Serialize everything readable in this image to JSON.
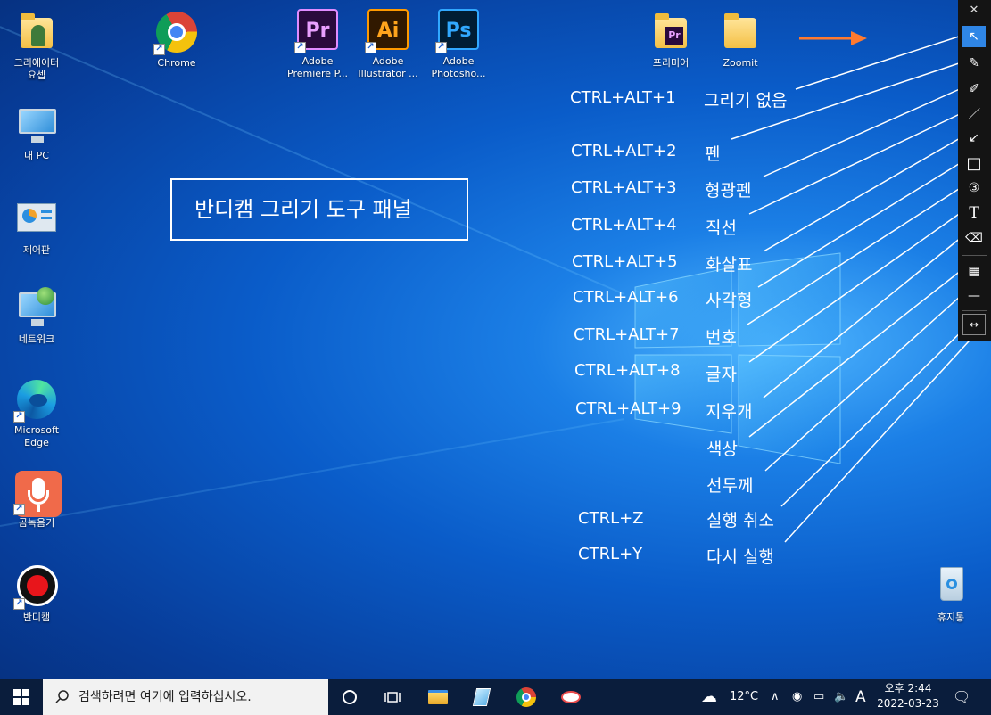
{
  "desktop_icons": [
    {
      "label": "크리에이터\n요셉"
    },
    {
      "label": "내 PC"
    },
    {
      "label": "제어판"
    },
    {
      "label": "네트워크"
    },
    {
      "label": "Microsoft\nEdge"
    },
    {
      "label": "곰녹음기"
    },
    {
      "label": "반디캠"
    },
    {
      "label": "Chrome"
    },
    {
      "label": "Adobe\nPremiere P...",
      "badge": "Pr"
    },
    {
      "label": "Adobe\nIllustrator ...",
      "badge": "Ai"
    },
    {
      "label": "Adobe\nPhotosho...",
      "badge": "Ps"
    },
    {
      "label": "프리미어"
    },
    {
      "label": "Zoomit"
    },
    {
      "label": "휴지통"
    }
  ],
  "title_box": "반디캠 그리기 도구 패널",
  "shortcuts": [
    {
      "keys": "CTRL+ALT+1",
      "desc": "그리기 없음"
    },
    {
      "keys": "CTRL+ALT+2",
      "desc": "펜"
    },
    {
      "keys": "CTRL+ALT+3",
      "desc": "형광펜"
    },
    {
      "keys": "CTRL+ALT+4",
      "desc": "직선"
    },
    {
      "keys": "CTRL+ALT+5",
      "desc": "화살표"
    },
    {
      "keys": "CTRL+ALT+6",
      "desc": "사각형"
    },
    {
      "keys": "CTRL+ALT+7",
      "desc": "번호"
    },
    {
      "keys": "CTRL+ALT+8",
      "desc": "글자"
    },
    {
      "keys": "CTRL+ALT+9",
      "desc": "지우개"
    },
    {
      "keys": "",
      "desc": "색상"
    },
    {
      "keys": "",
      "desc": "선두께"
    },
    {
      "keys": "CTRL+Z",
      "desc": "실행 취소"
    },
    {
      "keys": "CTRL+Y",
      "desc": "다시 실행"
    }
  ],
  "toolbar": {
    "close_glyph": "✕",
    "tools": [
      {
        "icon": "cursor-icon",
        "glyph": "↖"
      },
      {
        "icon": "pen-icon",
        "glyph": "✎"
      },
      {
        "icon": "highlighter-icon",
        "glyph": "✐"
      },
      {
        "icon": "line-icon",
        "glyph": "／"
      },
      {
        "icon": "arrow-icon",
        "glyph": "↙"
      },
      {
        "icon": "rectangle-icon",
        "glyph": "□"
      },
      {
        "icon": "number-icon",
        "glyph": "③"
      },
      {
        "icon": "text-icon",
        "glyph": "T"
      },
      {
        "icon": "eraser-icon",
        "glyph": "⌫"
      },
      {
        "icon": "color-icon",
        "glyph": "▦"
      },
      {
        "icon": "line-width-icon",
        "glyph": "—"
      },
      {
        "icon": "undo-redo-icon",
        "glyph": "↔"
      }
    ]
  },
  "taskbar": {
    "search_placeholder": "검색하려면 여기에 입력하십시오.",
    "weather": "12°C",
    "ime": "A",
    "time": "오후 2:44",
    "date": "2022-03-23"
  },
  "colors": {
    "accent": "#2f86e6",
    "arrow": "#ff7a2f",
    "taskbar": "#0a1d3c"
  }
}
